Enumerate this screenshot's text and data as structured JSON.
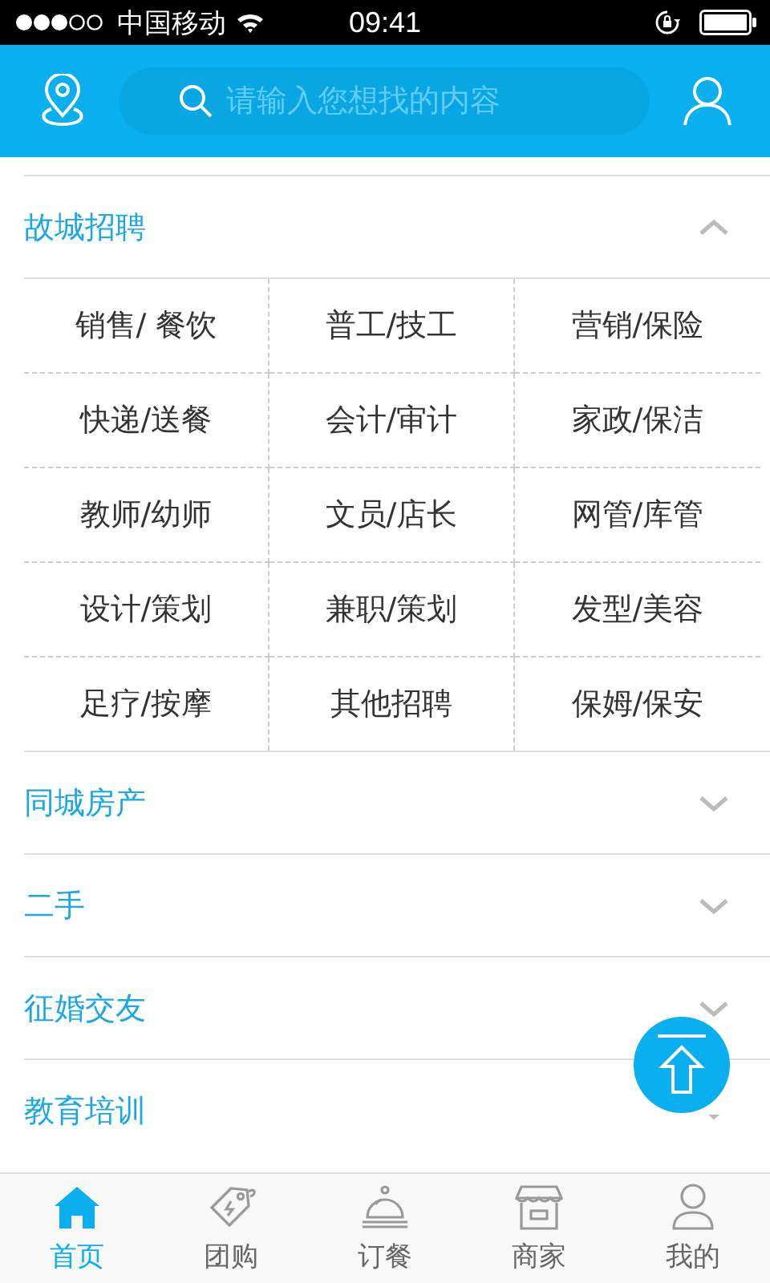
{
  "status_bar": {
    "carrier": "中国移动",
    "time": "09:41"
  },
  "header": {
    "search": {
      "placeholder": "请输入您想找的内容"
    }
  },
  "sections": [
    {
      "title": "故城招聘",
      "expanded": true,
      "items": [
        "销售/ 餐饮",
        "普工/技工",
        "营销/保险",
        "快递/送餐",
        "会计/审计",
        "家政/保洁",
        "教师/幼师",
        "文员/店长",
        "网管/库管",
        "设计/策划",
        "兼职/策划",
        "发型/美容",
        "足疗/按摩",
        "其他招聘",
        "保姆/保安"
      ]
    },
    {
      "title": "同城房产",
      "expanded": false
    },
    {
      "title": "二手",
      "expanded": false
    },
    {
      "title": "征婚交友",
      "expanded": false
    },
    {
      "title": "教育培训",
      "expanded": false
    }
  ],
  "tab_bar": [
    {
      "kind": "home",
      "label": "首页",
      "selected": true
    },
    {
      "kind": "tag",
      "label": "团购",
      "selected": false
    },
    {
      "kind": "cloche",
      "label": "订餐",
      "selected": false
    },
    {
      "kind": "shop",
      "label": "商家",
      "selected": false
    },
    {
      "kind": "person",
      "label": "我的",
      "selected": false
    }
  ]
}
